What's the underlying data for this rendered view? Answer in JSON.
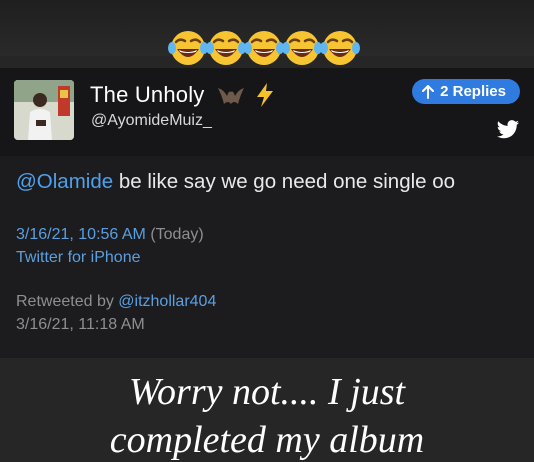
{
  "emojis": [
    "face-with-tears-of-joy",
    "face-with-tears-of-joy",
    "face-with-tears-of-joy",
    "face-with-tears-of-joy",
    "face-with-tears-of-joy"
  ],
  "tweet": {
    "display_name": "The Unholy",
    "handle": "@AyomideMuiz_",
    "replies_label": "2 Replies",
    "mention": "@Olamide",
    "text_rest": " be like say we go need one single oo",
    "date": "3/16/21, 10:56 AM",
    "date_suffix": " (Today)",
    "client": "Twitter for iPhone",
    "retweeted_prefix": "Retweeted by ",
    "retweeted_by": "@itzhollar404",
    "retweet_date": "3/16/21, 11:18 AM"
  },
  "caption": {
    "line1": "Worry not.... I just",
    "line2": "completed my album"
  },
  "colors": {
    "accent": "#2f7be0",
    "link": "#5b9fe0",
    "background": "#262626",
    "card": "#1c1c1e"
  },
  "icons": [
    "face-with-tears-of-joy",
    "bat-icon",
    "lightning-icon",
    "arrow-up-icon",
    "twitter-bird-icon"
  ]
}
